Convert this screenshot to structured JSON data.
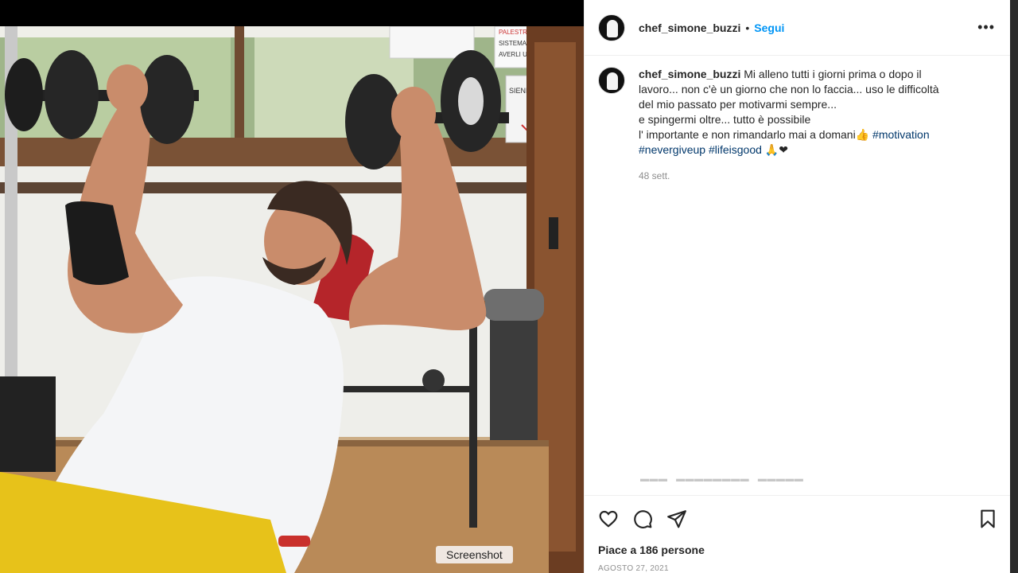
{
  "post": {
    "username": "chef_simone_buzzi",
    "separator": "•",
    "follow_label": "Segui",
    "more_icon": "more-horizontal-icon",
    "caption_lines": [
      "Mi alleno tutti i giorni prima o dopo il",
      "lavoro... non c'è un giorno che non lo faccia... uso le difficoltà",
      "del mio passato per motivarmi sempre...",
      "e spingermi oltre... tutto è possibile",
      "l' importante e non rimandarlo mai a domani👍"
    ],
    "hashtags": [
      "#motivation",
      "#nevergiveup",
      "#lifeisgood"
    ],
    "emojis": "🙏❤",
    "time_ago": "48 sett.",
    "likes_text": "Piace a 186 persone",
    "date_text": "AGOSTO 27, 2021"
  },
  "photo_signs": {
    "sign1": "PALESTRA C",
    "sign2": "SISTEMARE I PESI",
    "sign3": "AVERLI USAT",
    "sign4": "SIENIZZANTE"
  },
  "tooltip": "Screenshot",
  "colors": {
    "link": "#0095f6",
    "hashtag": "#00376b",
    "text": "#262626",
    "muted": "#8e8e8e"
  }
}
